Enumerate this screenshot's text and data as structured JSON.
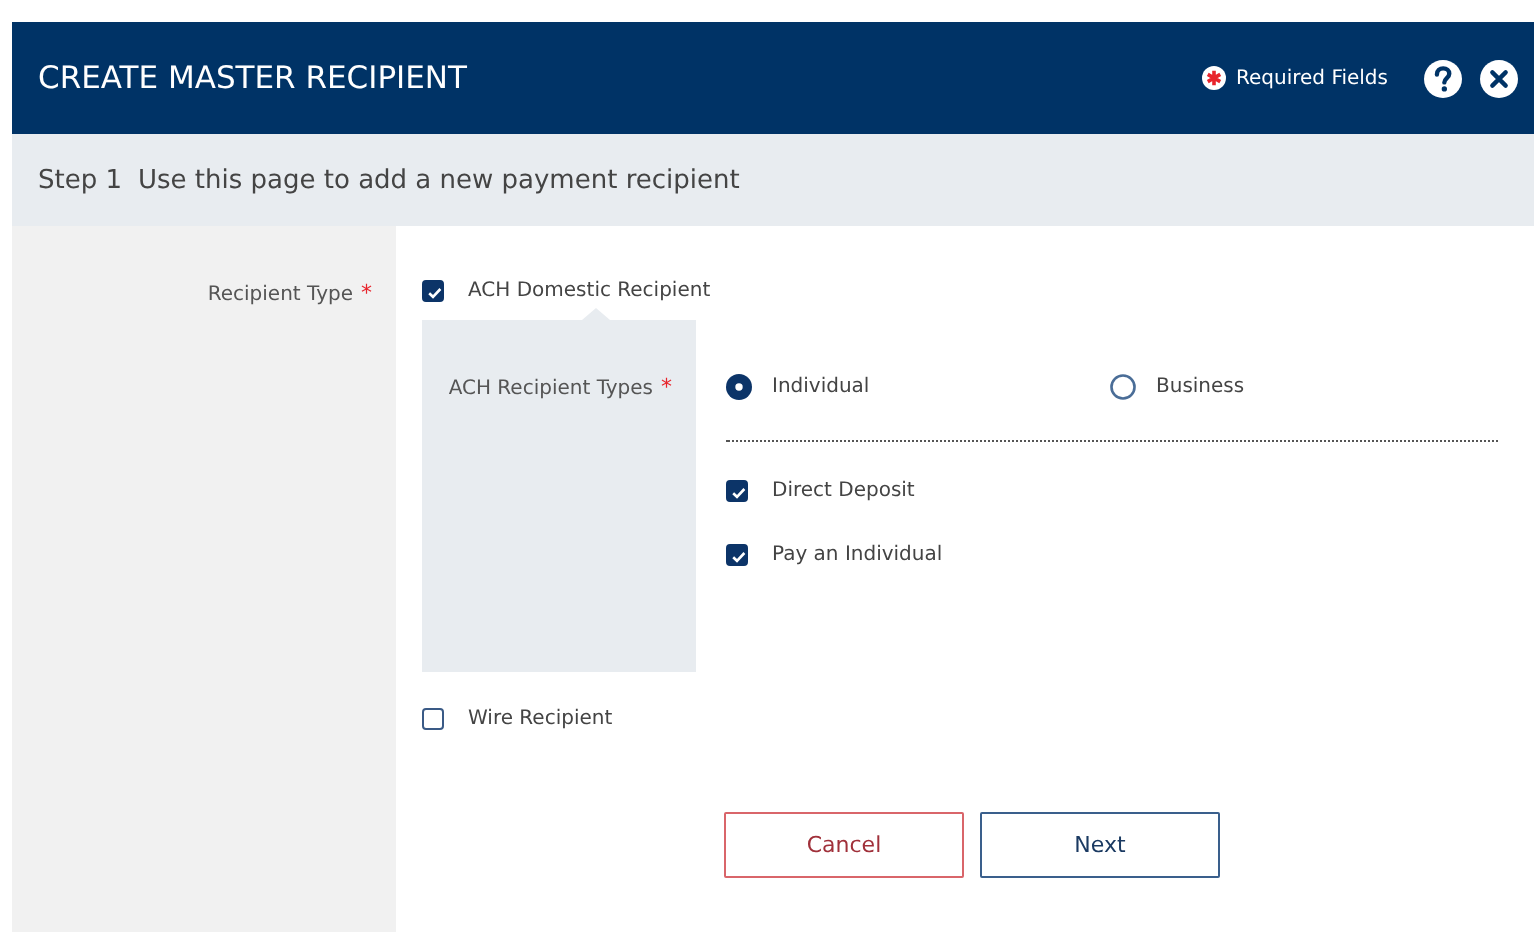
{
  "dialog": {
    "title": "CREATE MASTER RECIPIENT",
    "required_legend": "Required Fields"
  },
  "step": {
    "number": "Step 1",
    "text": "Use this page to add a new payment recipient"
  },
  "recipient_type": {
    "label": "Recipient Type",
    "required_mark": "*",
    "options": [
      {
        "label": "ACH Domestic Recipient",
        "checked": true,
        "panel": {
          "label": "ACH Recipient Types",
          "required_mark": "*",
          "radios": [
            {
              "label": "Individual",
              "selected": true
            },
            {
              "label": "Business",
              "selected": false
            }
          ],
          "sub_options": [
            {
              "label": "Direct Deposit",
              "checked": true
            },
            {
              "label": "Pay an Individual",
              "checked": true
            }
          ]
        }
      },
      {
        "label": "Wire Recipient",
        "checked": false
      }
    ]
  },
  "buttons": [
    {
      "label": "Cancel",
      "kind": "secondary"
    },
    {
      "label": "Next",
      "kind": "primary"
    }
  ]
}
